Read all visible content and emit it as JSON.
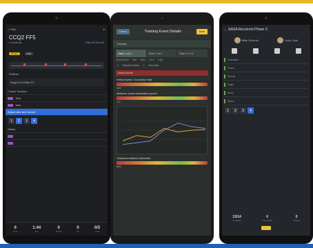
{
  "colors": {
    "accent_yellow": "#e7b623",
    "accent_blue": "#1f5fb5",
    "highlight": "#2f6fdb",
    "alert_red": "#c23a3a",
    "ok_green": "#6fbf4a"
  },
  "tablet1": {
    "back": "< Plan",
    "title": "CCQ2 FF5",
    "subtitle": "4 sessions",
    "link": "Filter All Events",
    "badges": [
      "RCAO",
      "Live"
    ],
    "section_label": "Fulltime",
    "group_label": "Support Hi-Rate ST",
    "rows": [
      "Cluster Session",
      "Task",
      "Task",
      "Adjust plan and record",
      "Status"
    ],
    "steps": [
      "1",
      "2",
      "3",
      "4"
    ],
    "stats": [
      {
        "value": "0",
        "label": "Time"
      },
      {
        "value": "1:44",
        "label": "Sec"
      },
      {
        "value": "0",
        "label": "Faults"
      },
      {
        "value": "0",
        "label": "Err"
      },
      {
        "value": "0/3",
        "label": "Total"
      }
    ]
  },
  "tablet2": {
    "cancel": "Cancel",
    "title": "Training Event Details",
    "done": "Done",
    "section": "Training",
    "tabs": [
      "Start 1 of 2",
      "Start 1 of 3",
      "Start 1 of 5"
    ],
    "info": [
      "Event 2019",
      "Test",
      "Hold",
      "1 of 4",
      "4 (b)"
    ],
    "flags": [
      "Segment failure",
      "Run back"
    ],
    "alert": "Hazard ahead",
    "meters": [
      {
        "label": "Vertical Speed / Touchdown Rate",
        "value": "115"
      },
      {
        "label": "Maximum normal acceleration ground",
        "value": "1.2"
      },
      {
        "label": "Touchdown distance (threshold)",
        "value": "520"
      }
    ],
    "chart_data": {
      "type": "line",
      "series": [
        {
          "values": [
            0.2,
            0.35,
            0.3,
            0.55,
            0.45,
            0.5,
            0.52
          ]
        },
        {
          "values": [
            0.1,
            0.15,
            0.2,
            0.5,
            0.7,
            0.6,
            0.55
          ]
        }
      ],
      "ylim": [
        0,
        1
      ]
    }
  },
  "tablet3": {
    "title": "EASA Recurrent Phase C",
    "people": [
      "Mike Gilchrist",
      "Kelly Cook"
    ],
    "icons": [
      "Eval",
      "Notes",
      "Grade",
      "Report"
    ],
    "rows": [
      "Evaluation",
      "Phase",
      "Aircraft",
      "Flight",
      "Items",
      "Status"
    ],
    "steps": [
      "1",
      "2",
      "3",
      "4"
    ],
    "footer": [
      {
        "value": "13/14",
        "label": "Complete"
      },
      {
        "value": "0",
        "label": "Incomplete"
      },
      {
        "value": "0",
        "label": "Missed"
      }
    ]
  }
}
